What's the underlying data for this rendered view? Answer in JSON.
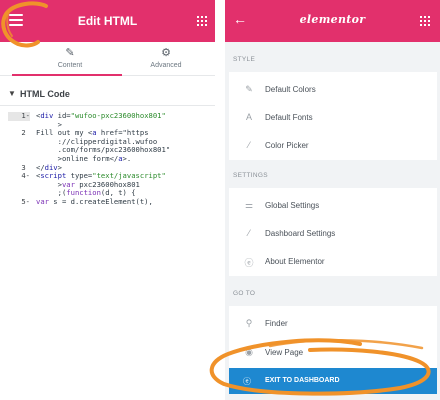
{
  "left_panel": {
    "header": {
      "title": "Edit HTML"
    },
    "tabs": [
      {
        "label": "Content",
        "icon": "pencil-icon"
      },
      {
        "label": "Advanced",
        "icon": "gear-icon"
      }
    ],
    "section": {
      "title": "HTML Code"
    },
    "code_lines": [
      {
        "num": "1",
        "marker": "-",
        "text": "<div id=\"wufoo-pxc23600hox801\""
      },
      {
        "num": "",
        "marker": "",
        "text": "     >"
      },
      {
        "num": "2",
        "marker": "",
        "text": "Fill out my <a href=\"https"
      },
      {
        "num": "",
        "marker": "",
        "text": "     ://clipperdigital.wufoo"
      },
      {
        "num": "",
        "marker": "",
        "text": "     .com/forms/pxc23600hox801\""
      },
      {
        "num": "",
        "marker": "",
        "text": "     >online form</a>."
      },
      {
        "num": "3",
        "marker": "",
        "text": "</div>"
      },
      {
        "num": "4",
        "marker": "-",
        "text": "<script type=\"text/javascript\""
      },
      {
        "num": "",
        "marker": "",
        "text": "     >var pxc23600hox801"
      },
      {
        "num": "",
        "marker": "",
        "text": "     ;(function(d, t) {"
      },
      {
        "num": "5",
        "marker": "-",
        "text": "var s = d.createElement(t),"
      }
    ]
  },
  "right_panel": {
    "header": {
      "logo": "elementor"
    },
    "groups": [
      {
        "label": "STYLE",
        "items": [
          {
            "label": "Default Colors",
            "icon": "pencil-icon"
          },
          {
            "label": "Default Fonts",
            "icon": "font-icon"
          },
          {
            "label": "Color Picker",
            "icon": "eyedropper-icon"
          }
        ]
      },
      {
        "label": "SETTINGS",
        "items": [
          {
            "label": "Global Settings",
            "icon": "sliders-icon"
          },
          {
            "label": "Dashboard Settings",
            "icon": "settings-icon"
          },
          {
            "label": "About Elementor",
            "icon": "info-icon"
          }
        ]
      },
      {
        "label": "GO TO",
        "items": [
          {
            "label": "Finder",
            "icon": "search-icon"
          },
          {
            "label": "View Page",
            "icon": "eye-icon"
          }
        ]
      }
    ],
    "exit_button": {
      "label": "EXIT TO DASHBOARD",
      "icon": "elementor-icon"
    }
  },
  "colors": {
    "header": "#e2306c",
    "exit_button": "#1e88d0",
    "annotation": "#f0922a"
  }
}
